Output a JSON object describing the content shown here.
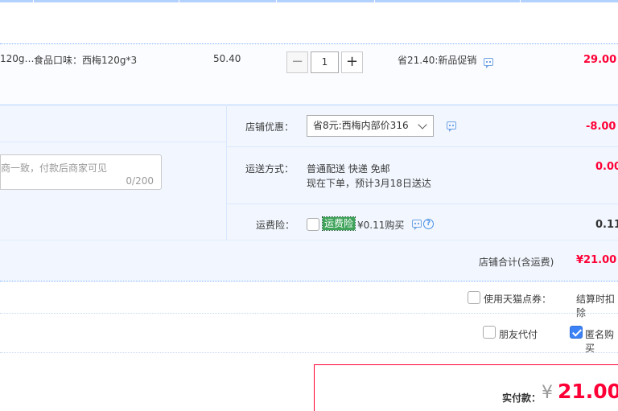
{
  "product": {
    "title_fragment": "120g…",
    "sku_label": "食品口味：西梅120g*3",
    "unit_price": "50.40",
    "quantity": "1",
    "qty_minus": "−",
    "qty_plus": "+",
    "promo": "省21.40:新品促销",
    "subtotal": "29.00"
  },
  "shop": {
    "discount_label": "店铺优惠：",
    "discount_selected": "省8元:西梅内部价316",
    "discount_amount": "-8.00",
    "message_placeholder": "商一致，付款后商家可见",
    "message_count": "0/200",
    "shipping_label": "运送方式：",
    "shipping_method": "普通配送 快递 免邮",
    "shipping_eta": "现在下单，预计3月18日送达",
    "shipping_fee": "0.00",
    "insurance_label": "运费险：",
    "insurance_badge": "运费险",
    "insurance_price": "¥0.11购买",
    "insurance_amount": "0.11",
    "help_glyph": "?",
    "total_label": "店铺合计(含运费)",
    "total_value": "¥21.00"
  },
  "options": {
    "tmall_points_label": "使用天猫点券：",
    "tmall_points_note": "结算时扣除",
    "friend_pay_label": "朋友代付",
    "anonymous_label": "匿名购买",
    "anonymous_checked": true
  },
  "payment": {
    "label": "实付款：",
    "currency": "¥",
    "amount": "21.00"
  },
  "colors": {
    "accent_red": "#ff0036",
    "accent_blue": "#b2d1ff"
  }
}
